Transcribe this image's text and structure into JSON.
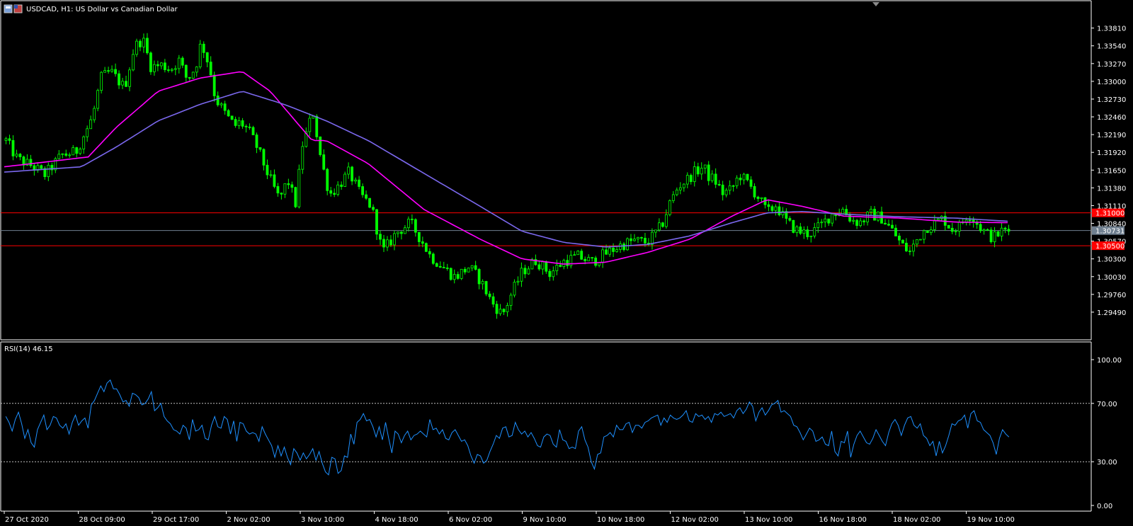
{
  "header": {
    "symbol_title": "USDCAD, H1:  US Dollar vs Canadian Dollar",
    "rsi_title": "RSI(14) 46.15"
  },
  "colors": {
    "background": "#000000",
    "frame": "#ffffff",
    "candle": "#00ff00",
    "ma_fast": "#ff00ff",
    "ma_slow": "#7b68ee",
    "rsi": "#1e90ff",
    "resistance": "#ff0000",
    "price_line": "#708090"
  },
  "chart_data": [
    {
      "type": "candlestick",
      "title": "USDCAD, H1:  US Dollar vs Canadian Dollar",
      "x_tick_labels": [
        "27 Oct 2020",
        "28 Oct 09:00",
        "29 Oct 17:00",
        "2 Nov 02:00",
        "3 Nov 10:00",
        "4 Nov 18:00",
        "6 Nov 02:00",
        "9 Nov 10:00",
        "10 Nov 18:00",
        "12 Nov 02:00",
        "13 Nov 10:00",
        "16 Nov 18:00",
        "18 Nov 02:00",
        "19 Nov 10:00"
      ],
      "y_tick_labels": [
        "1.33810",
        "1.33540",
        "1.33270",
        "1.33000",
        "1.32730",
        "1.32460",
        "1.32190",
        "1.31920",
        "1.31650",
        "1.31380",
        "1.31110",
        "1.30840",
        "1.30570",
        "1.30300",
        "1.30030",
        "1.29760",
        "1.29490"
      ],
      "ylim": [
        1.2922,
        1.34
      ],
      "num_bars": 285,
      "close_path": [
        [
          0,
          1.321
        ],
        [
          8,
          1.3182
        ],
        [
          18,
          1.3172
        ],
        [
          28,
          1.3158
        ],
        [
          40,
          1.3188
        ],
        [
          50,
          1.3192
        ],
        [
          62,
          1.3245
        ],
        [
          68,
          1.3305
        ],
        [
          75,
          1.3315
        ],
        [
          85,
          1.329
        ],
        [
          92,
          1.3352
        ],
        [
          98,
          1.3365
        ],
        [
          104,
          1.3322
        ],
        [
          112,
          1.3325
        ],
        [
          118,
          1.3318
        ],
        [
          124,
          1.3332
        ],
        [
          130,
          1.3302
        ],
        [
          136,
          1.3322
        ],
        [
          140,
          1.336
        ],
        [
          146,
          1.3322
        ],
        [
          150,
          1.3275
        ],
        [
          158,
          1.3248
        ],
        [
          164,
          1.3232
        ],
        [
          168,
          1.3238
        ],
        [
          174,
          1.3225
        ],
        [
          180,
          1.32
        ],
        [
          188,
          1.3158
        ],
        [
          196,
          1.312
        ],
        [
          202,
          1.315
        ],
        [
          208,
          1.3112
        ],
        [
          212,
          1.32
        ],
        [
          216,
          1.3225
        ],
        [
          220,
          1.3255
        ],
        [
          226,
          1.318
        ],
        [
          232,
          1.3128
        ],
        [
          238,
          1.314
        ],
        [
          246,
          1.3162
        ],
        [
          254,
          1.3128
        ],
        [
          262,
          1.311
        ],
        [
          270,
          1.304
        ],
        [
          280,
          1.307
        ],
        [
          290,
          1.3085
        ],
        [
          298,
          1.3058
        ],
        [
          304,
          1.3035
        ],
        [
          312,
          1.302
        ],
        [
          322,
          1.3002
        ],
        [
          332,
          1.3018
        ],
        [
          340,
          1.2998
        ],
        [
          348,
          1.2965
        ],
        [
          356,
          1.2945
        ],
        [
          362,
          1.2975
        ],
        [
          370,
          1.301
        ],
        [
          380,
          1.3028
        ],
        [
          390,
          1.3008
        ],
        [
          400,
          1.3026
        ],
        [
          410,
          1.3034
        ],
        [
          420,
          1.3025
        ],
        [
          430,
          1.3038
        ],
        [
          440,
          1.305
        ],
        [
          450,
          1.3058
        ],
        [
          460,
          1.3055
        ],
        [
          470,
          1.308
        ],
        [
          476,
          1.3115
        ],
        [
          482,
          1.314
        ],
        [
          488,
          1.315
        ],
        [
          494,
          1.3162
        ],
        [
          500,
          1.317
        ],
        [
          504,
          1.3155
        ],
        [
          508,
          1.315
        ],
        [
          514,
          1.313
        ],
        [
          520,
          1.3135
        ],
        [
          526,
          1.3158
        ],
        [
          532,
          1.3145
        ],
        [
          540,
          1.3122
        ],
        [
          546,
          1.31
        ],
        [
          552,
          1.3112
        ],
        [
          560,
          1.3085
        ],
        [
          568,
          1.3072
        ],
        [
          576,
          1.3068
        ],
        [
          584,
          1.308
        ],
        [
          592,
          1.3098
        ],
        [
          600,
          1.3105
        ],
        [
          606,
          1.309
        ],
        [
          612,
          1.3085
        ],
        [
          620,
          1.3098
        ],
        [
          628,
          1.3092
        ],
        [
          636,
          1.3072
        ],
        [
          642,
          1.3052
        ],
        [
          648,
          1.304
        ],
        [
          654,
          1.3062
        ],
        [
          660,
          1.3078
        ],
        [
          666,
          1.3085
        ],
        [
          672,
          1.3092
        ],
        [
          678,
          1.3075
        ],
        [
          684,
          1.308
        ],
        [
          690,
          1.31
        ],
        [
          696,
          1.3085
        ],
        [
          702,
          1.307
        ],
        [
          708,
          1.3062
        ],
        [
          714,
          1.3072
        ],
        [
          719,
          1.3073
        ]
      ],
      "moving_averages": [
        {
          "color": "#ff00ff",
          "path": [
            [
              0,
              1.317
            ],
            [
              60,
              1.3185
            ],
            [
              80,
              1.323
            ],
            [
              110,
              1.3285
            ],
            [
              140,
              1.3305
            ],
            [
              170,
              1.3315
            ],
            [
              190,
              1.3285
            ],
            [
              220,
              1.321
            ],
            [
              230,
              1.321
            ],
            [
              260,
              1.3175
            ],
            [
              300,
              1.3105
            ],
            [
              340,
              1.306
            ],
            [
              370,
              1.303
            ],
            [
              400,
              1.3022
            ],
            [
              430,
              1.3025
            ],
            [
              460,
              1.304
            ],
            [
              490,
              1.306
            ],
            [
              520,
              1.3095
            ],
            [
              545,
              1.312
            ],
            [
              570,
              1.311
            ],
            [
              600,
              1.3095
            ],
            [
              640,
              1.3092
            ],
            [
              680,
              1.3086
            ],
            [
              719,
              1.3085
            ]
          ]
        },
        {
          "color": "#7b68ee",
          "path": [
            [
              0,
              1.3162
            ],
            [
              55,
              1.317
            ],
            [
              80,
              1.32
            ],
            [
              110,
              1.324
            ],
            [
              140,
              1.3265
            ],
            [
              170,
              1.3285
            ],
            [
              200,
              1.3265
            ],
            [
              230,
              1.324
            ],
            [
              260,
              1.321
            ],
            [
              300,
              1.316
            ],
            [
              340,
              1.311
            ],
            [
              370,
              1.3072
            ],
            [
              400,
              1.3055
            ],
            [
              430,
              1.3048
            ],
            [
              460,
              1.3052
            ],
            [
              490,
              1.3065
            ],
            [
              520,
              1.3085
            ],
            [
              545,
              1.31
            ],
            [
              570,
              1.3102
            ],
            [
              600,
              1.3098
            ],
            [
              640,
              1.3094
            ],
            [
              680,
              1.3092
            ],
            [
              719,
              1.3087
            ]
          ]
        }
      ],
      "horizontal_levels": [
        {
          "value": 1.31,
          "label": "1.31000",
          "color": "#ff0000"
        },
        {
          "value": 1.305,
          "label": "1.30500",
          "color": "#ff0000"
        },
        {
          "value": 1.30731,
          "label": "1.30731",
          "color": "#708090"
        }
      ]
    },
    {
      "type": "line",
      "title": "RSI(14) 46.15",
      "y_tick_labels": [
        "100.00",
        "70.00",
        "30.00",
        "0.00"
      ],
      "ylim": [
        0,
        100
      ],
      "levels": [
        70,
        30
      ],
      "series": [
        {
          "values": [
            61,
            57,
            51,
            59,
            64,
            56,
            46,
            52,
            43,
            40,
            52,
            57,
            62,
            52,
            55,
            61,
            60,
            55,
            53,
            56,
            49,
            57,
            62,
            55,
            58,
            60,
            53,
            69,
            72,
            77,
            82,
            78,
            84,
            86,
            80,
            80,
            76,
            71,
            72,
            68,
            77,
            76,
            74,
            69,
            70,
            73,
            78,
            65,
            67,
            70,
            61,
            58,
            56,
            52,
            51,
            49,
            55,
            53,
            45,
            59,
            51,
            52,
            55,
            46,
            45,
            55,
            61,
            54,
            53,
            61,
            59,
            49,
            58,
            44,
            57,
            56,
            51,
            49,
            50,
            49,
            44,
            54,
            49,
            45,
            41,
            33,
            41,
            34,
            40,
            33,
            28,
            39,
            36,
            31,
            36,
            32,
            35,
            39,
            31,
            37,
            29,
            23,
            21,
            33,
            32,
            22,
            24,
            34,
            33,
            49,
            42,
            57,
            59,
            63,
            58,
            59,
            54,
            47,
            54,
            45,
            57,
            46,
            36,
            51,
            49,
            43,
            48,
            51,
            45,
            48,
            49,
            51,
            49,
            47,
            59,
            52,
            53,
            49,
            52,
            46,
            45,
            50,
            52,
            48,
            44,
            45,
            41,
            34,
            29,
            35,
            34,
            29,
            31,
            37,
            42,
            48,
            46,
            53,
            54,
            47,
            48,
            57,
            52,
            49,
            51,
            47,
            50,
            46,
            41,
            40,
            47,
            49,
            48,
            42,
            40,
            52,
            45,
            44,
            39,
            40,
            39,
            51,
            54,
            45,
            40,
            30,
            25,
            35,
            36,
            47,
            48,
            50,
            47,
            55,
            52,
            52,
            56,
            57,
            50,
            55,
            55,
            53,
            57,
            58,
            60,
            61,
            62,
            55,
            60,
            57,
            62,
            60,
            59,
            60,
            62,
            65,
            58,
            57,
            63,
            61,
            62,
            59,
            61,
            57,
            63,
            62,
            64,
            61,
            62,
            63,
            60,
            65,
            67,
            63,
            66,
            71,
            68,
            58,
            64,
            67,
            62,
            65,
            69,
            70,
            72,
            64,
            65,
            63,
            61,
            55,
            54,
            50,
            45,
            49,
            53,
            51,
            44,
            45,
            47,
            42,
            41,
            51,
            37,
            34,
            44,
            43,
            51,
            33,
            42,
            48,
            51,
            47,
            43,
            42,
            46,
            52,
            48,
            44,
            41,
            50,
            56,
            59,
            55,
            48,
            55,
            60,
            61,
            55,
            53,
            56,
            48,
            46,
            41,
            44,
            34,
            44,
            36,
            41,
            48,
            56,
            55,
            58,
            59,
            62,
            53,
            63,
            65,
            58,
            57,
            52,
            50,
            48,
            43,
            35,
            46,
            52,
            49,
            47
          ]
        }
      ]
    }
  ]
}
